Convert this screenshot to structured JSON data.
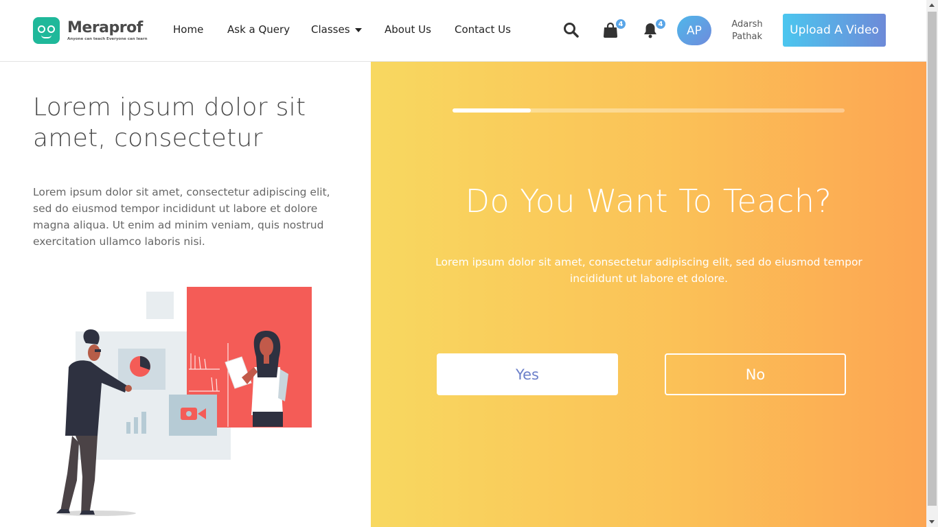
{
  "brand": {
    "name": "Meraprof",
    "tagline": "Anyone can teach Everyone can learn",
    "color": "#1fb89a"
  },
  "nav": {
    "items": [
      {
        "label": "Home"
      },
      {
        "label": "Ask a Query"
      },
      {
        "label": "Classes"
      },
      {
        "label": "About Us"
      },
      {
        "label": "Contact Us"
      }
    ]
  },
  "header_icons": {
    "search": {
      "icon": "search-icon"
    },
    "bag": {
      "icon": "shopping-bag-icon",
      "badge": "4"
    },
    "bell": {
      "icon": "bell-icon",
      "badge": "4"
    }
  },
  "user": {
    "initials": "AP",
    "first_name": "Adarsh",
    "last_name": "Pathak"
  },
  "upload_button": "Upload A Video",
  "left": {
    "title": "Lorem ipsum dolor sit amet, consectetur",
    "description": "Lorem ipsum dolor sit amet, consectetur adipiscing elit, sed do eiusmod tempor incididunt ut labore et dolore magna aliqua. Ut enim ad minim veniam, quis nostrud exercitation ullamco laboris nisi."
  },
  "question": {
    "progress": 0.2,
    "title": "Do You Want To Teach?",
    "description": "Lorem ipsum dolor sit amet, consectetur adipiscing elit, sed do eiusmod tempor incididunt ut labore et dolore.",
    "yes_label": "Yes",
    "no_label": "No"
  },
  "colors": {
    "accent_gradient_start": "#f8d860",
    "accent_gradient_end": "#fca552",
    "upload_gradient_start": "#4bc6ef",
    "upload_gradient_end": "#6d8ad8",
    "illustration_red": "#f45c57"
  }
}
